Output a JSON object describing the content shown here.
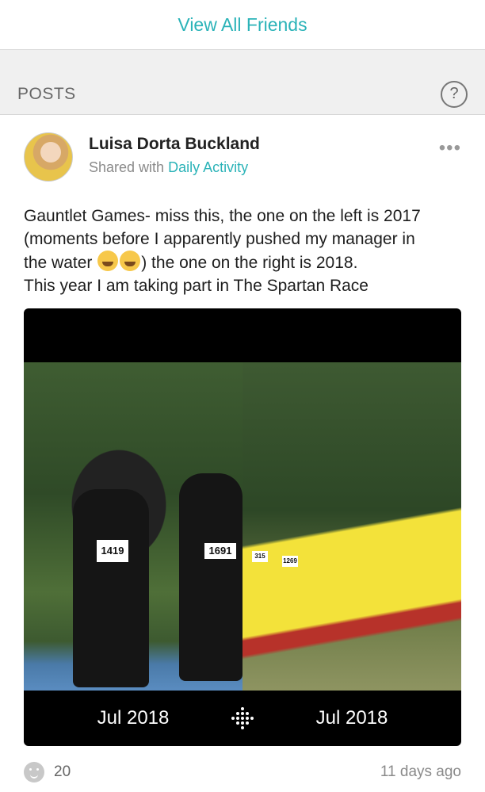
{
  "top": {
    "view_all_friends": "View All Friends"
  },
  "section": {
    "title": "POSTS",
    "help_glyph": "?"
  },
  "post": {
    "author": "Luisa Dorta Buckland",
    "shared_prefix": "Shared with",
    "shared_group": "Daily Activity",
    "more_glyph": "•••",
    "text_line1": "Gauntlet Games- miss this, the one on the left is 2017",
    "text_line2": "(moments before I apparently pushed my manager in",
    "text_line3_start": "the water",
    "text_line3_end": ") the one on the right is 2018.",
    "text_line4": "This year I am taking part in The Spartan Race",
    "emojis": [
      "face-with-tears-of-joy-icon",
      "winking-face-with-tongue-icon"
    ],
    "photo": {
      "left_caption": "Jul 2018",
      "right_caption": "Jul 2018",
      "left_bib_1": "1419",
      "left_bib_2": "1691",
      "right_bib_1": "315",
      "right_bib_2": "1269"
    },
    "cheer_count": "20",
    "time_ago": "11 days ago"
  },
  "colors": {
    "accent": "#2bb3b8",
    "section_bg": "#f0f0f0"
  }
}
